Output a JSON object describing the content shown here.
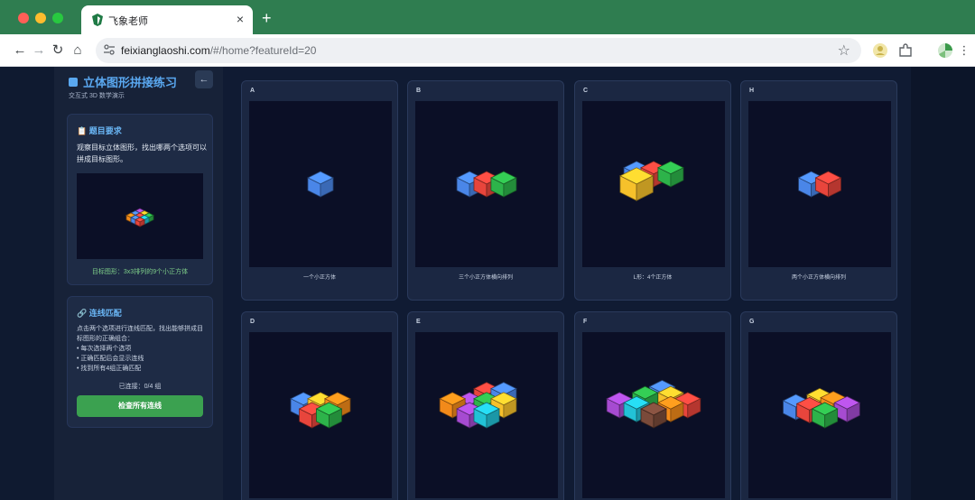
{
  "browser": {
    "tab_title": "飞象老师",
    "tab_close": "×",
    "new_tab": "+",
    "url_host": "feixianglaoshi.com",
    "url_rest": "/#/home?featureId=20",
    "nav": {
      "back": "←",
      "forward": "→",
      "reload": "↻",
      "home": "⌂"
    },
    "star": "☆"
  },
  "sidebar": {
    "title": "立体图形拼接练习",
    "subtitle": "交互式 3D 数学演示",
    "back_button": "←",
    "requirement": {
      "title": "📋 题目要求",
      "text": "观察目标立体图形，找出哪两个选项可以拼成目标图形。",
      "target_caption": "目标图形：3x3排列的9个小正方体"
    },
    "matching": {
      "title": "🔗 连线匹配",
      "intro": "点击两个选项进行连线匹配，找出能够拼成目标图形的正确组合：",
      "bullets": [
        "• 每次选择两个选项",
        "• 正确匹配后会显示连线",
        "• 找到所有4组正确匹配"
      ],
      "status": "已连接：0/4 组",
      "check_button": "检查所有连线"
    }
  },
  "options": [
    {
      "letter": "A",
      "caption": "一个小正方体",
      "cubes": [
        [
          "blue",
          0,
          0
        ]
      ]
    },
    {
      "letter": "B",
      "caption": "三个小正方体横向排列",
      "cubes": [
        [
          "blue",
          -1,
          0
        ],
        [
          "red",
          0,
          0
        ],
        [
          "green",
          1,
          0
        ]
      ]
    },
    {
      "letter": "C",
      "caption": "L形：4个正方体",
      "cubes": [
        [
          "blue",
          -1,
          -1
        ],
        [
          "red",
          0,
          -1
        ],
        [
          "green",
          1,
          -1
        ],
        [
          "yellow",
          -1,
          0,
          1.3
        ]
      ]
    },
    {
      "letter": "H",
      "caption": "两个小正方体横向排列",
      "cubes": [
        [
          "blue",
          -0.5,
          0
        ],
        [
          "red",
          0.5,
          0
        ]
      ]
    },
    {
      "letter": "D",
      "caption": "",
      "cubes": [
        [
          "blue",
          -1,
          -1
        ],
        [
          "yellow",
          0,
          -1
        ],
        [
          "orange",
          1,
          -1
        ],
        [
          "red",
          -0.5,
          0
        ],
        [
          "green",
          0.5,
          0
        ]
      ]
    },
    {
      "letter": "E",
      "caption": "",
      "cubes": [
        [
          "red",
          0,
          -2
        ],
        [
          "blue",
          1,
          -2
        ],
        [
          "purple",
          -1,
          -1
        ],
        [
          "green",
          0,
          -1
        ],
        [
          "orange",
          -2,
          -1
        ],
        [
          "yellow",
          1,
          -1
        ],
        [
          "purple",
          -1,
          0
        ],
        [
          "cyan",
          0,
          0
        ]
      ]
    },
    {
      "letter": "F",
      "caption": "",
      "cubes": [
        [
          "blue",
          0.5,
          -2.2
        ],
        [
          "yellow",
          1,
          -1.6
        ],
        [
          "green",
          -0.5,
          -1.6
        ],
        [
          "purple",
          -2,
          -1
        ],
        [
          "red",
          2,
          -1
        ],
        [
          "cyan",
          -1,
          -0.6
        ],
        [
          "orange",
          1,
          -0.6
        ],
        [
          "brown",
          0,
          0
        ]
      ]
    },
    {
      "letter": "G",
      "caption": "",
      "cubes": [
        [
          "yellow",
          0,
          -1.4
        ],
        [
          "orange",
          0.8,
          -1.1
        ],
        [
          "blue",
          -1.4,
          -0.8
        ],
        [
          "purple",
          1.6,
          -0.6
        ],
        [
          "red",
          -0.6,
          -0.5
        ],
        [
          "green",
          0.3,
          0
        ]
      ]
    }
  ],
  "target_cubes": "3x3",
  "colors": {
    "blue": "#4a86e8",
    "red": "#e8453c",
    "green": "#2db34a",
    "yellow": "#f6c12b",
    "orange": "#f28a1a",
    "purple": "#a64bd1",
    "cyan": "#22c2d6",
    "brown": "#7a4a3a"
  }
}
